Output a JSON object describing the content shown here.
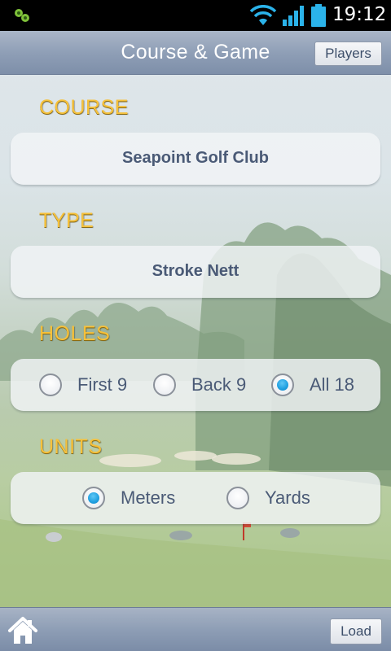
{
  "status_bar": {
    "time": "19:12",
    "icons": [
      "app-notification-icon",
      "wifi-icon",
      "signal-icon",
      "battery-icon"
    ]
  },
  "header": {
    "title": "Course & Game",
    "players_label": "Players"
  },
  "sections": {
    "course": {
      "label": "COURSE",
      "value": "Seapoint Golf Club"
    },
    "type": {
      "label": "TYPE",
      "value": "Stroke Nett"
    },
    "holes": {
      "label": "HOLES",
      "options": [
        {
          "label": "First 9",
          "selected": false
        },
        {
          "label": "Back 9",
          "selected": false
        },
        {
          "label": "All 18",
          "selected": true
        }
      ]
    },
    "units": {
      "label": "UNITS",
      "options": [
        {
          "label": "Meters",
          "selected": true
        },
        {
          "label": "Yards",
          "selected": false
        }
      ]
    }
  },
  "footer": {
    "home_icon": "home-icon",
    "load_label": "Load"
  },
  "colors": {
    "section_label": "#f6c13b",
    "text_primary": "#4a5a76",
    "radio_selected": "#1e9fe0",
    "bar": "#8d9db5"
  }
}
